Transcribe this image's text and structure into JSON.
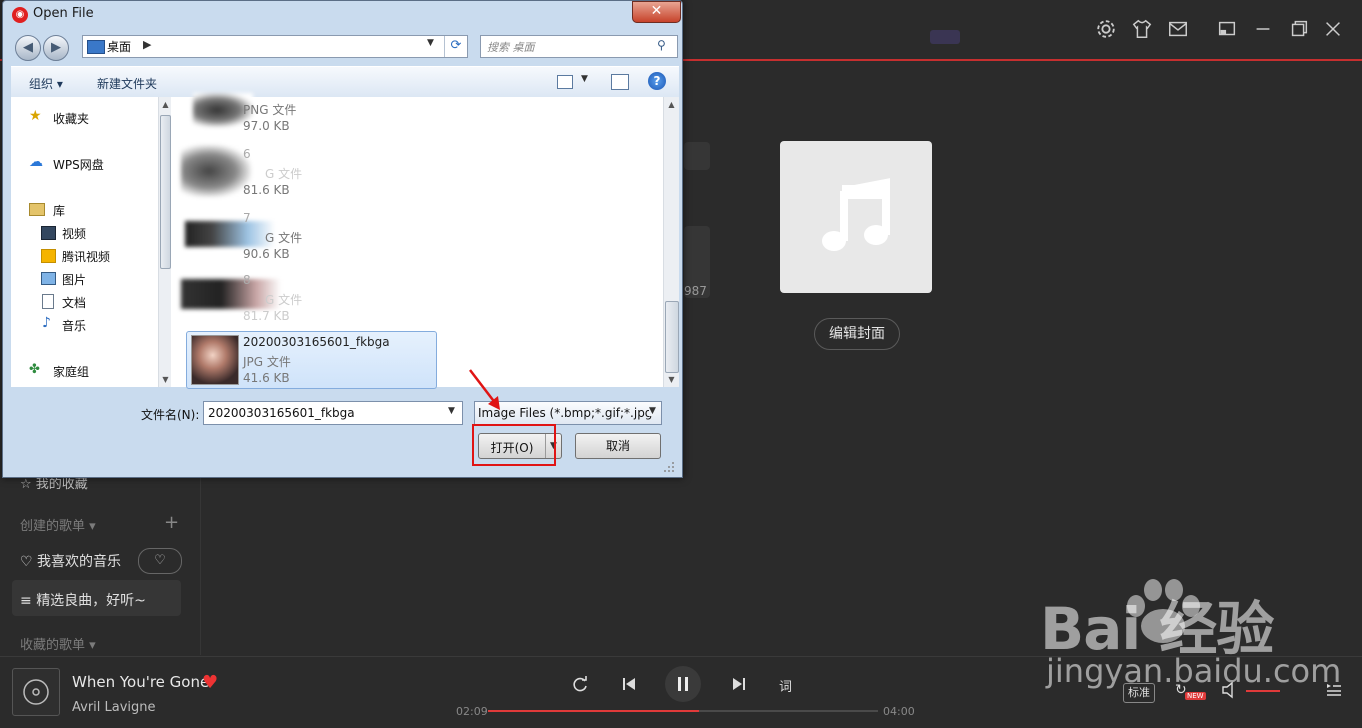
{
  "app": {
    "sidebar": {
      "fav_partial": "我的收藏",
      "created_section": "创建的歌单",
      "liked_music": "我喜欢的音乐",
      "selected_playlist": "精选良曲，好听~",
      "collected_section": "收藏的歌单"
    },
    "main": {
      "edit_cover": "编辑封面",
      "stub_text": "987"
    },
    "player": {
      "title": "When You're Gone",
      "artist": "Avril Lavigne",
      "time_current": "02:09",
      "time_total": "04:00",
      "progress": 0.54,
      "lyrics_btn": "词",
      "quality": "标准",
      "new_badge": "NEW"
    },
    "watermark": {
      "logo": "Bai  经验",
      "url": "jingyan.baidu.com"
    },
    "colors": {
      "accent": "#c62f2f",
      "background": "#2b2b2b"
    }
  },
  "dialog": {
    "title": "Open File",
    "close_glyph": "✕",
    "address": "桌面",
    "search_placeholder": "搜索 桌面",
    "commands": {
      "organize": "组织 ▾",
      "new_folder": "新建文件夹"
    },
    "nav": [
      {
        "label": "收藏夹",
        "icon": "star-icon"
      },
      {
        "label": "WPS网盘",
        "icon": "cloud-icon"
      },
      {
        "label": "库",
        "icon": "library-icon"
      },
      {
        "label": "视频",
        "icon": "video-icon"
      },
      {
        "label": "腾讯视频",
        "icon": "tencent-video-icon"
      },
      {
        "label": "图片",
        "icon": "picture-icon"
      },
      {
        "label": "文档",
        "icon": "document-icon"
      },
      {
        "label": "音乐",
        "icon": "music-icon"
      },
      {
        "label": "家庭组",
        "icon": "homegroup-icon"
      }
    ],
    "files": [
      {
        "name": "",
        "type": "PNG 文件",
        "size": "97.0 KB"
      },
      {
        "name": "6",
        "type": "G 文件",
        "size": "81.6 KB"
      },
      {
        "name": "7",
        "type": "G 文件",
        "size": "90.6 KB"
      },
      {
        "name": "8",
        "type": "G 文件",
        "size": "81.7 KB"
      },
      {
        "name": "20200303165601_fkbga",
        "type": "JPG 文件",
        "size": "41.6 KB"
      }
    ],
    "filename_label": "文件名(N):",
    "filename_value": "20200303165601_fkbga",
    "filter_value": "Image Files (*.bmp;*.gif;*.jpg",
    "open_label": "打开(O)",
    "cancel_label": "取消"
  }
}
